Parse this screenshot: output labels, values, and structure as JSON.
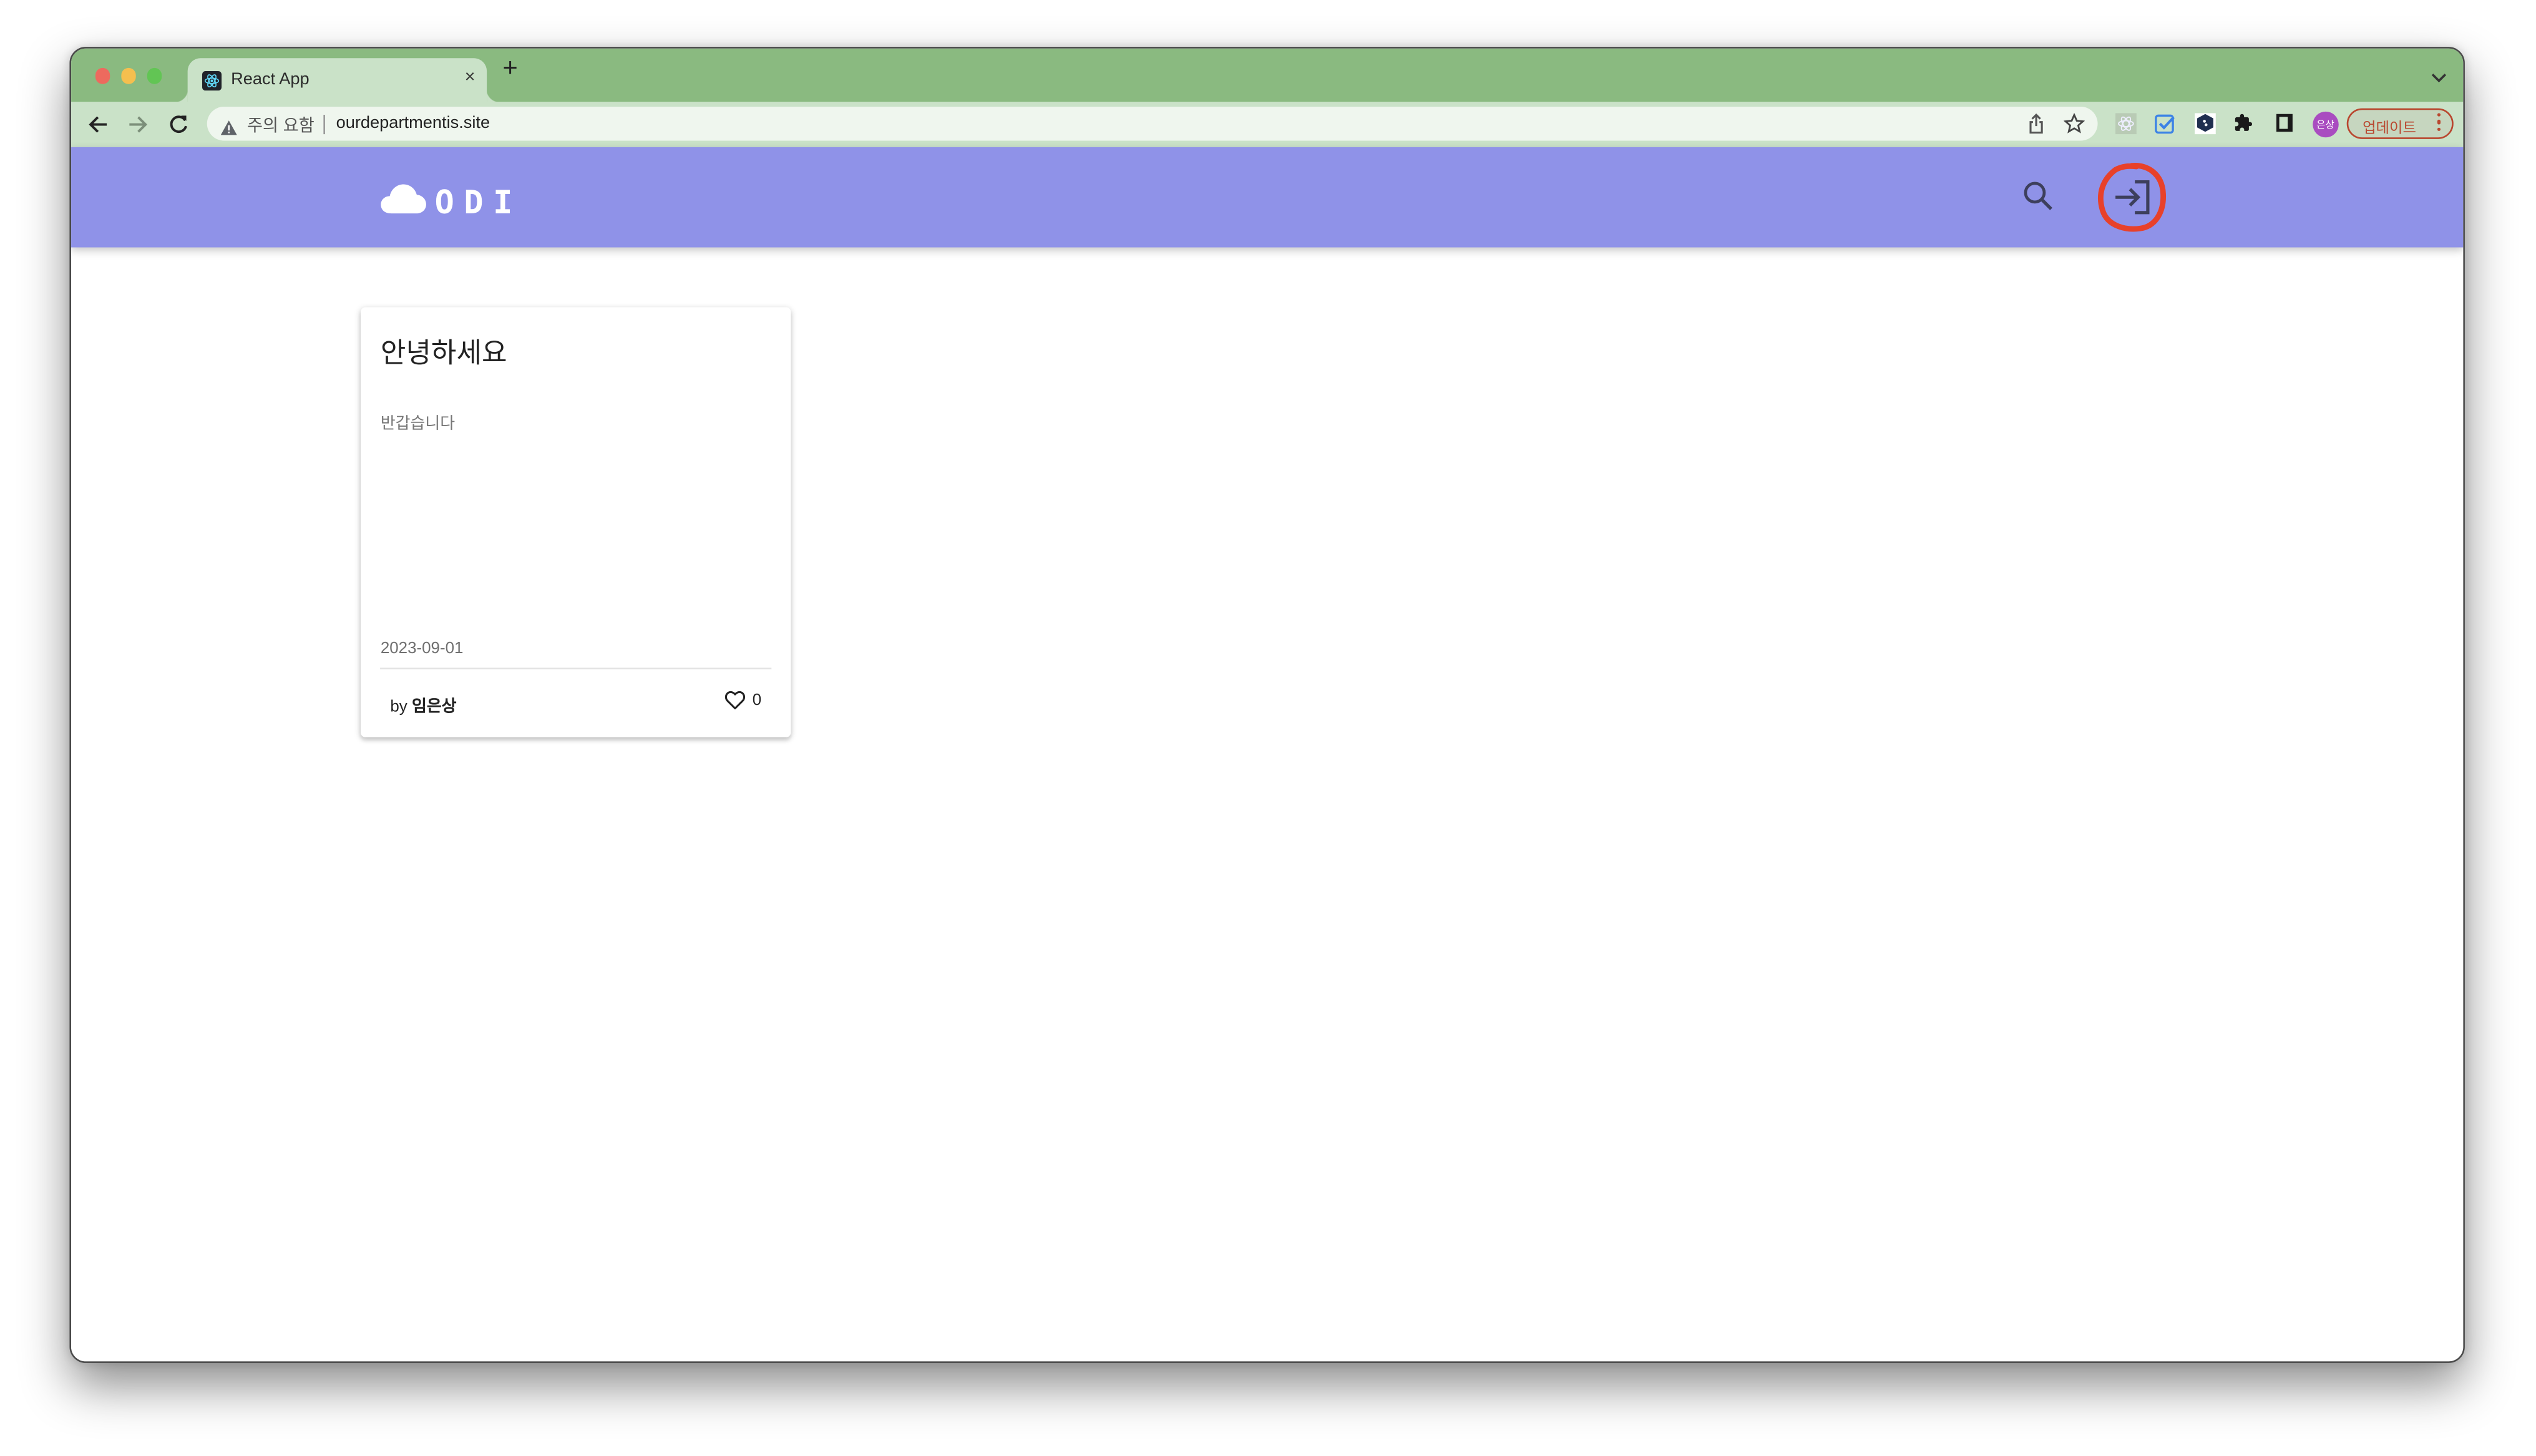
{
  "browser": {
    "tab": {
      "title": "React App",
      "favicon": "react-logo-icon",
      "close_label": "×"
    },
    "new_tab_label": "+",
    "tab_search_icon": "chevron-down-icon",
    "nav": {
      "back": "arrow-left-icon",
      "forward": "arrow-right-icon",
      "reload": "reload-icon"
    },
    "omnibox": {
      "security_icon": "warning-triangle-icon",
      "security_label": "주의 요함",
      "url": "ourdepartmentis.site",
      "actions": [
        "share-icon",
        "star-icon"
      ]
    },
    "extensions": [
      "react-devtools-icon",
      "checkbox-extension-icon",
      "hexagon-extension-icon",
      "puzzle-icon",
      "side-panel-icon"
    ],
    "profile_label": "은상",
    "profile_color": "#a94cc0",
    "update_label": "업데이트",
    "update_color": "#b9472f",
    "frame_color": "#8aba80",
    "toolbar_color": "#cae2c8"
  },
  "app": {
    "header_color": "#8f92e8",
    "logo_text": "ODI",
    "logo_icon": "cloud-icon",
    "search_icon": "search-icon",
    "login_icon": "login-icon",
    "annotation_color": "#e8412a"
  },
  "posts": [
    {
      "title": "안녕하세요",
      "body": "반갑습니다",
      "date": "2023-09-01",
      "by_label": "by",
      "author": "임은상",
      "likes": "0"
    }
  ]
}
